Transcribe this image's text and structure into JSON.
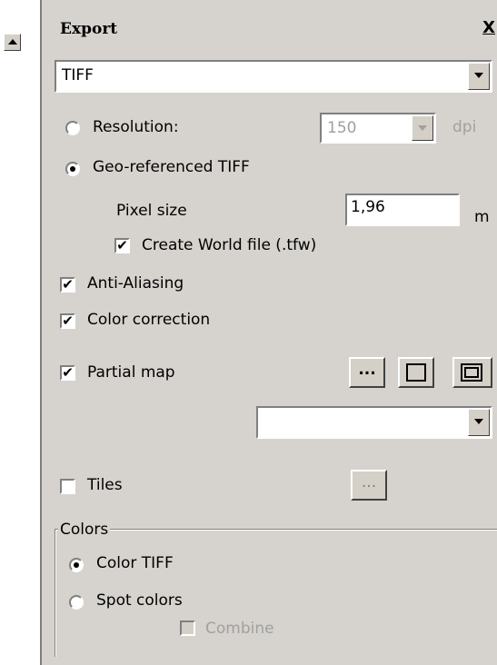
{
  "panel": {
    "title": "Export",
    "close_label": "X"
  },
  "format": {
    "selected": "TIFF"
  },
  "resolution": {
    "label": "Resolution:",
    "value": "150",
    "unit": "dpi"
  },
  "georef": {
    "label": "Geo-referenced TIFF",
    "pixel_size_label": "Pixel size",
    "pixel_size_value": "1,96",
    "pixel_size_unit": "m",
    "world_file_label": "Create World file (.tfw)"
  },
  "options": {
    "antialias_label": "Anti-Aliasing",
    "color_correction_label": "Color correction",
    "partial_map_label": "Partial map",
    "partial_ellipsis": "...",
    "partial_dropdown_value": "",
    "tiles_label": "Tiles",
    "tiles_ellipsis": "..."
  },
  "colors": {
    "group_label": "Colors",
    "color_tiff_label": "Color TIFF",
    "spot_colors_label": "Spot colors",
    "combine_label": "Combine"
  },
  "checkmark": "✔",
  "style": {
    "panel_bg": "#d6d3ce",
    "disabled_text": "#a0a0a0"
  }
}
